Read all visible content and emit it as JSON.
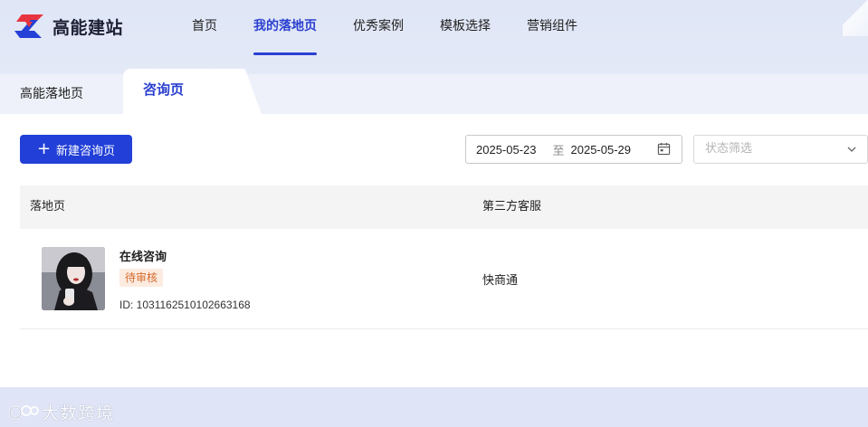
{
  "brand": {
    "name": "高能建站"
  },
  "nav": {
    "items": [
      {
        "label": "首页",
        "active": false
      },
      {
        "label": "我的落地页",
        "active": true
      },
      {
        "label": "优秀案例",
        "active": false
      },
      {
        "label": "模板选择",
        "active": false
      },
      {
        "label": "营销组件",
        "active": false
      }
    ]
  },
  "tabs": [
    {
      "label": "高能落地页",
      "active": false
    },
    {
      "label": "咨询页",
      "active": true
    }
  ],
  "toolbar": {
    "new_button_label": "新建咨询页",
    "date_start": "2025-05-23",
    "date_separator": "至",
    "date_end": "2025-05-29",
    "status_placeholder": "状态筛选"
  },
  "table": {
    "columns": [
      "落地页",
      "第三方客服"
    ],
    "rows": [
      {
        "title": "在线咨询",
        "status": "待审核",
        "id_text": "ID: 1031162510102663168",
        "service": "快商通"
      }
    ]
  },
  "watermark": {
    "text": "大数跨境"
  },
  "colors": {
    "accent": "#2a3fcf",
    "primary_button": "#2240d8",
    "badge_bg": "#fcebe0",
    "badge_text": "#d46a2a"
  }
}
